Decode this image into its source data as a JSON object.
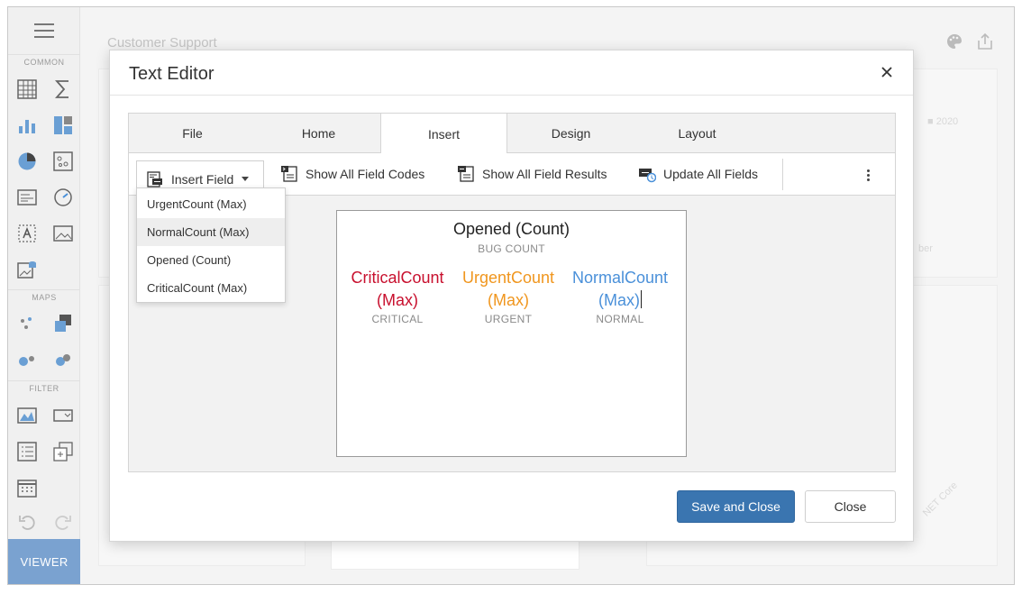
{
  "dashboard": {
    "title": "Customer Support",
    "legend_2020": "2020",
    "bg_label_1": "ber",
    "bg_label_2": "NET Core"
  },
  "toolbox": {
    "sections": {
      "common": "COMMON",
      "maps": "MAPS",
      "filter": "FILTER"
    },
    "viewer_label": "VIEWER"
  },
  "dialog": {
    "title": "Text Editor",
    "tabs": [
      {
        "label": "File"
      },
      {
        "label": "Home"
      },
      {
        "label": "Insert",
        "active": true
      },
      {
        "label": "Design"
      },
      {
        "label": "Layout"
      }
    ],
    "ribbon": {
      "insert_field": "Insert Field",
      "show_codes": "Show All Field Codes",
      "show_results": "Show All Field Results",
      "update_fields": "Update All Fields"
    },
    "dropdown": [
      {
        "label": "UrgentCount (Max)"
      },
      {
        "label": "NormalCount (Max)",
        "hover": true
      },
      {
        "label": "Opened (Count)"
      },
      {
        "label": "CriticalCount (Max)"
      }
    ],
    "document": {
      "title": "Opened (Count)",
      "subtitle": "BUG COUNT",
      "metrics": [
        {
          "value_line1": "CriticalCount",
          "value_line2": "(Max)",
          "label": "CRITICAL",
          "color": "#c8102e"
        },
        {
          "value_line1": "UrgentCount",
          "value_line2": "(Max)",
          "label": "URGENT",
          "color": "#f0961e"
        },
        {
          "value_line1": "NormalCount",
          "value_line2": "(Max)",
          "label": "NORMAL",
          "color": "#4a90d9"
        }
      ]
    },
    "buttons": {
      "save_close": "Save and Close",
      "close": "Close"
    }
  },
  "colors": {
    "primary": "#3a75b0",
    "viewer": "#7aa2d0"
  }
}
